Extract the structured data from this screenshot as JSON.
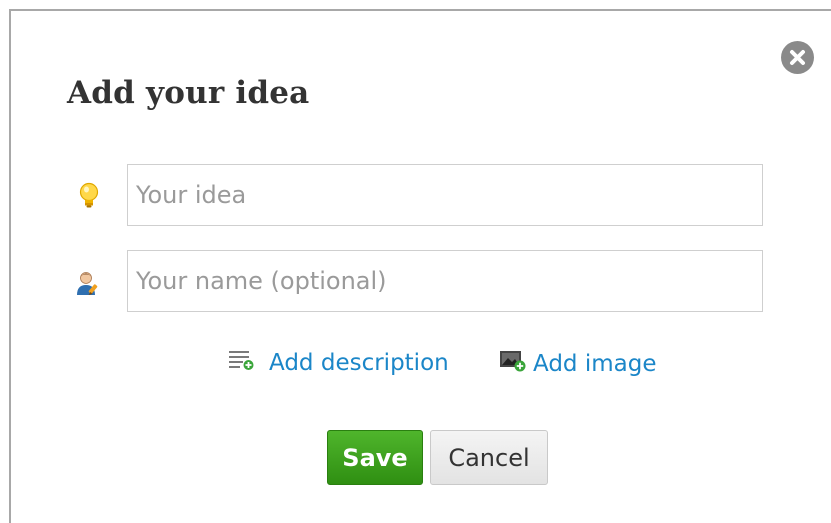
{
  "dialog": {
    "title": "Add your idea",
    "close_icon": "close-circle-icon",
    "idea_field": {
      "icon": "lightbulb-icon",
      "placeholder": "Your idea",
      "value": ""
    },
    "name_field": {
      "icon": "user-pencil-icon",
      "placeholder": "Your name (optional)",
      "value": ""
    },
    "links": {
      "add_description": "Add description",
      "add_description_icon": "add-lines-icon",
      "add_image": "Add image",
      "add_image_icon": "add-image-icon"
    },
    "buttons": {
      "save": "Save",
      "cancel": "Cancel"
    },
    "colors": {
      "link": "#1b86c8",
      "save_button": "#3c9f1c",
      "close_button": "#8a8a8a",
      "title": "#333333"
    }
  }
}
